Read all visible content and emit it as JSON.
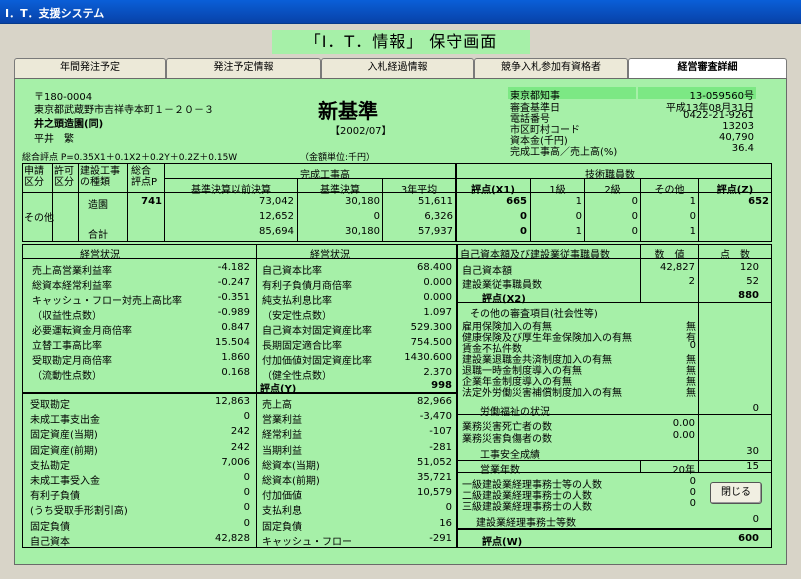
{
  "window_title": "I．T．支援システム",
  "header_title": "「I．T．情報」 保守画面",
  "tabs": [
    "年間発注予定",
    "発注予定情報",
    "入札経過情報",
    "競争入札参加有資格者",
    "経営審査詳細"
  ],
  "company": {
    "postal": "〒180-0004",
    "address": "東京都武蔵野市吉祥寺本町１－２０－３",
    "name": "井之頭造園(同)",
    "rep": "平井　繁",
    "standard": "新基準",
    "period": "【2002/07】",
    "formula": "総合評点  P=0.35X1＋0.1X2＋0.2Y＋0.2Z＋0.15W",
    "unit": "（金額単位:千円）"
  },
  "info": {
    "permit_label": "東京都知事",
    "permit_no": "13-059560号",
    "base_date_label": "審査基準日",
    "base_date": "平成13年08月31日",
    "phone_label": "電話番号",
    "phone": "0422-21-9261",
    "city_code_label": "市区町村コード",
    "city_code": "13203",
    "capital_label": "資本金(千円)",
    "capital": "40,790",
    "ratio_label": "完成工事高／売上高(%)",
    "ratio": "36.4"
  },
  "table1": {
    "h_app": "申請\n区分",
    "h_perm": "許可\n区分",
    "h_kind": "建設工事\nの種類",
    "h_score": "総合\n評点P",
    "h_completed": "完成工事高",
    "h_before": "基準決算以前決算",
    "h_base": "基準決算",
    "h_avg": "3年平均",
    "h_x1": "評点(X1)",
    "h_tech": "技術職員数",
    "h_l1": "1級",
    "h_l2": "2級",
    "h_other": "その他",
    "h_z": "評点(Z)",
    "app": "その他",
    "kind": "造園",
    "total_label": "合計",
    "score_p": "741",
    "rows": [
      {
        "before": "73,042",
        "base": "30,180",
        "avg": "51,611",
        "x1": "665",
        "l1": "1",
        "l2": "0",
        "oth": "1",
        "z": "652"
      },
      {
        "before": "12,652",
        "base": "0",
        "avg": "6,326",
        "x1": "0",
        "l1": "0",
        "l2": "0",
        "oth": "0",
        "z": ""
      },
      {
        "before": "85,694",
        "base": "30,180",
        "avg": "57,937",
        "x1": "0",
        "l1": "1",
        "l2": "0",
        "oth": "1",
        "z": ""
      }
    ]
  },
  "mgmt1": {
    "title": "経営状況",
    "items": [
      {
        "label": "売上高営業利益率",
        "value": "-4.182"
      },
      {
        "label": "総資本経常利益率",
        "value": "-0.247"
      },
      {
        "label": "キャッシュ・フロー対売上高比率",
        "value": "-0.351"
      },
      {
        "label": "（収益性点数）",
        "value": "-0.989"
      },
      {
        "label": "必要運転資金月商倍率",
        "value": "0.847"
      },
      {
        "label": "立替工事高比率",
        "value": "15.504"
      },
      {
        "label": "受取勘定月商倍率",
        "value": "1.860"
      },
      {
        "label": "（流動性点数）",
        "value": "0.168"
      }
    ]
  },
  "mgmt2": {
    "title": "経営状況",
    "items": [
      {
        "label": "自己資本比率",
        "value": "68.400"
      },
      {
        "label": "有利子負債月商倍率",
        "value": "0.000"
      },
      {
        "label": "純支払利息比率",
        "value": "0.000"
      },
      {
        "label": "（安定性点数）",
        "value": "1.097"
      },
      {
        "label": "自己資本対固定資産比率",
        "value": "529.300"
      },
      {
        "label": "長期固定適合比率",
        "value": "754.500"
      },
      {
        "label": "付加価値対固定資産比率",
        "value": "1430.600"
      },
      {
        "label": "（健全性点数）",
        "value": "2.370"
      }
    ],
    "y_label": "評点(Y)",
    "y_value": "998"
  },
  "fin1": [
    {
      "label": "受取勘定",
      "value": "12,863"
    },
    {
      "label": "未成工事支出金",
      "value": "0"
    },
    {
      "label": "固定資産(当期)",
      "value": "242"
    },
    {
      "label": "固定資産(前期)",
      "value": "242"
    },
    {
      "label": "支払勘定",
      "value": "7,006"
    },
    {
      "label": "未成工事受入金",
      "value": "0"
    },
    {
      "label": "有利子負債",
      "value": "0"
    },
    {
      "label": "(うち受取手形割引高)",
      "value": "0"
    },
    {
      "label": "固定負債",
      "value": "0"
    },
    {
      "label": "自己資本",
      "value": "42,828"
    }
  ],
  "fin2": [
    {
      "label": "売上高",
      "value": "82,966"
    },
    {
      "label": "営業利益",
      "value": "-3,470"
    },
    {
      "label": "経常利益",
      "value": "-107"
    },
    {
      "label": "当期利益",
      "value": "-281"
    },
    {
      "label": "総資本(当期)",
      "value": "51,052"
    },
    {
      "label": "総資本(前期)",
      "value": "35,721"
    },
    {
      "label": "付加価値",
      "value": "10,579"
    },
    {
      "label": "支払利息",
      "value": "0"
    },
    {
      "label": "固定負債",
      "value": "16"
    },
    {
      "label": "キャッシュ・フロー",
      "value": "-291"
    }
  ],
  "x2": {
    "title": "自己資本額及び建設業従事職員数",
    "h_val": "数　値",
    "h_pts": "点　数",
    "rows": [
      {
        "label": "自己資本額",
        "value": "42,827",
        "pts": "120"
      },
      {
        "label": "建設業従事職員数",
        "value": "2",
        "pts": "52"
      }
    ],
    "score_label": "評点(X2)",
    "score": "880"
  },
  "social": {
    "title": "その他の審査項目(社会性等)",
    "items": [
      {
        "label": "雇用保険加入の有無",
        "value": "無"
      },
      {
        "label": "健康保険及び厚生年金保険加入の有無",
        "value": "有"
      },
      {
        "label": "賃金不払件数",
        "value": "0"
      },
      {
        "label": "建設業退職金共済制度加入の有無",
        "value": "無"
      },
      {
        "label": "退職一時金制度導入の有無",
        "value": "無"
      },
      {
        "label": "企業年金制度導入の有無",
        "value": "無"
      },
      {
        "label": "法定外労働災害補償制度加入の有無",
        "value": "無"
      }
    ],
    "welfare_label": "労働福祉の状況",
    "welfare": "0",
    "accident1_label": "業務災害死亡者の数",
    "accident1": "0.00",
    "accident2_label": "業務災害負傷者の数",
    "accident2": "0.00",
    "safety_label": "工事安全成績",
    "safety": "30",
    "years_label": "営業年数",
    "years_a": "20年",
    "years_b": "15",
    "eng": [
      {
        "label": "一級建設業経理事務士等の人数",
        "value": "0"
      },
      {
        "label": "二級建設業経理事務士の人数",
        "value": "0"
      },
      {
        "label": "三級建設業経理事務士の人数",
        "value": "0"
      }
    ],
    "eng_pts_label": "建設業経理事務士等数",
    "eng_pts": "0",
    "w_label": "評点(W)",
    "w": "600"
  },
  "close_label": "閉じる"
}
